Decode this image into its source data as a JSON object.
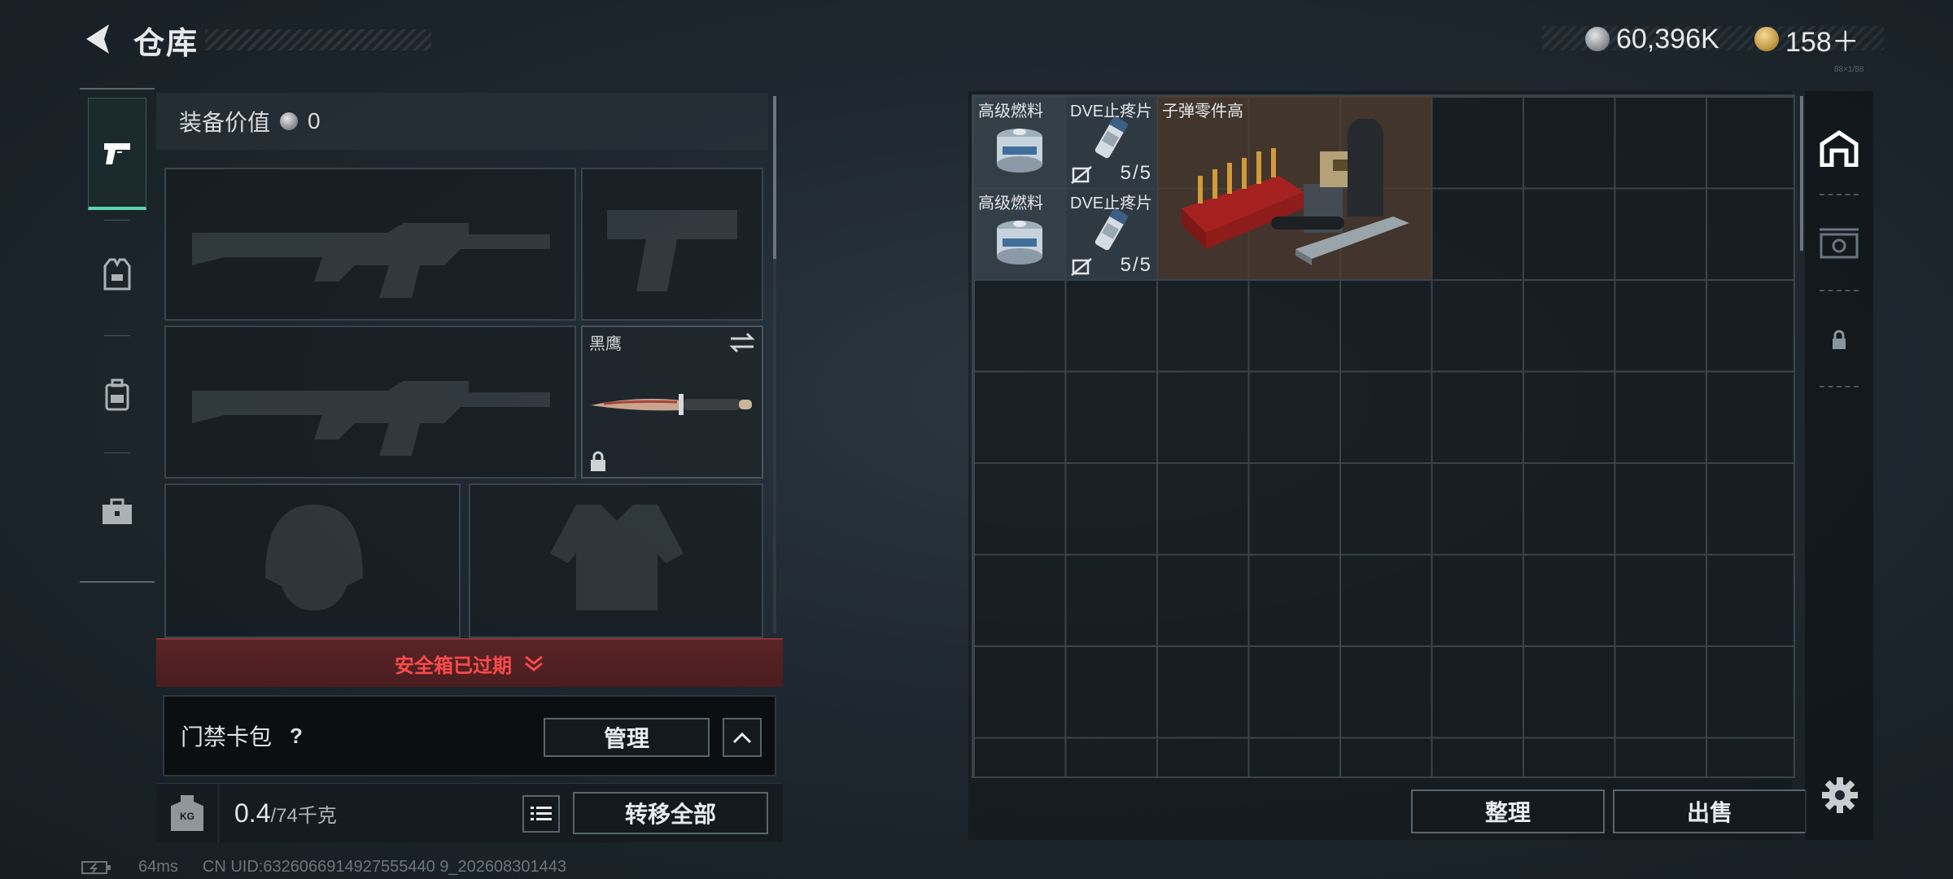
{
  "header": {
    "title": "仓库",
    "currencies": [
      {
        "icon": "silver-coin-icon",
        "amount": "60,396K",
        "color": "#b8bcc0"
      },
      {
        "icon": "gold-triangle-coin-icon",
        "amount": "158＋",
        "color": "#d7b060"
      }
    ]
  },
  "left_rail": {
    "tabs": [
      {
        "icon": "pistol-icon",
        "active": true
      },
      {
        "icon": "armor-vest-icon",
        "active": false
      },
      {
        "icon": "backpack-icon",
        "active": false
      },
      {
        "icon": "toolbox-icon",
        "active": false
      }
    ]
  },
  "equipment": {
    "value_label": "装备价值",
    "value_amount": "0",
    "melee_name": "黑鹰",
    "safe_box_status": "安全箱已过期",
    "keycard_label": "门禁卡包",
    "help_symbol": "?",
    "manage_label": "管理",
    "weight_current": "0.4",
    "weight_max": "/74千克",
    "transfer_all_label": "转移全部",
    "kg_badge": "KG"
  },
  "stash": {
    "items": [
      {
        "name": "高级燃料",
        "icon": "fuel-can-icon",
        "count": ""
      },
      {
        "name": "DVE止疼片",
        "icon": "painkiller-tube-icon",
        "count": "5/5"
      },
      {
        "name": "子弹零件高",
        "icon": "ammo-parts-crate-icon",
        "count": ""
      },
      {
        "name": "高级燃料",
        "icon": "fuel-can-icon",
        "count": ""
      },
      {
        "name": "DVE止疼片",
        "icon": "painkiller-tube-icon",
        "count": "5/5"
      }
    ],
    "sort_label": "整理",
    "sell_label": "出售"
  },
  "side_rail": {
    "tabs": [
      {
        "icon": "stash-home-icon",
        "active": true
      },
      {
        "icon": "money-case-icon",
        "active": false
      },
      {
        "icon": "lock-icon",
        "active": false
      }
    ],
    "small_text": "88×1/88"
  },
  "status": {
    "ping": "64ms",
    "uid": "CN UID:6326066914927555440 9_202608301443"
  }
}
